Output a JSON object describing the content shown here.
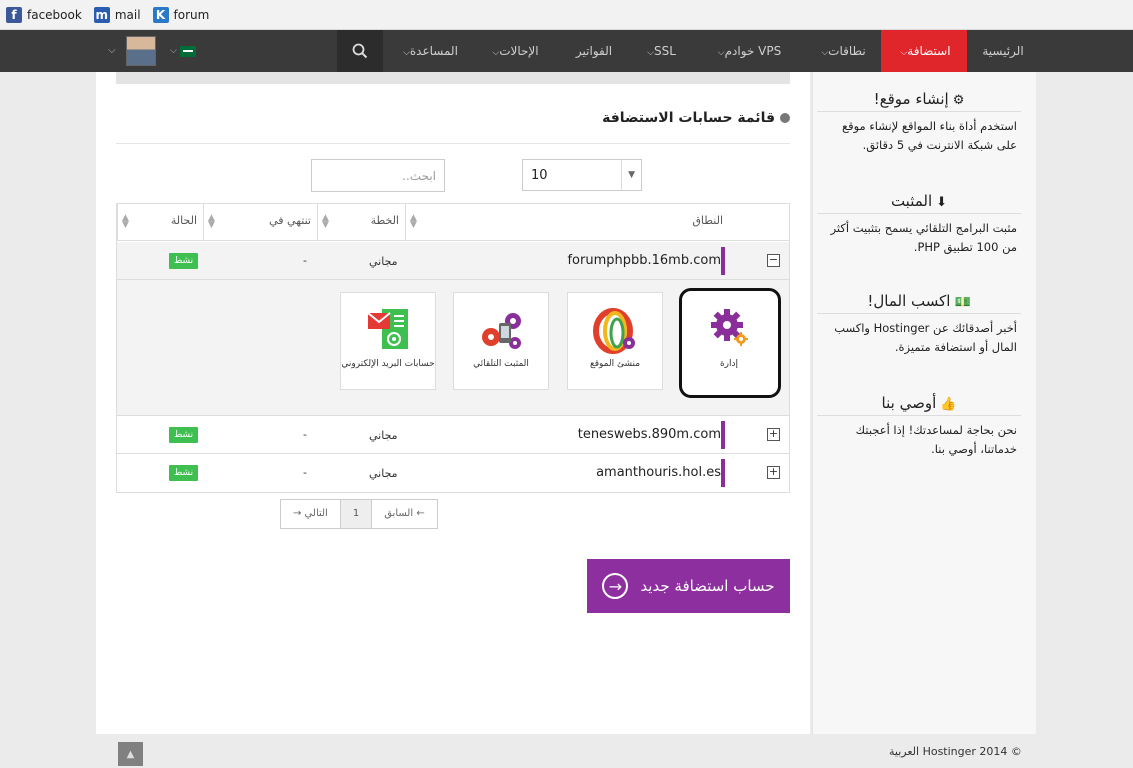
{
  "bookmarks": [
    {
      "label": "facebook",
      "icon": "facebook-icon"
    },
    {
      "label": "mail",
      "icon": "mail-icon"
    },
    {
      "label": "forum",
      "icon": "forum-icon"
    }
  ],
  "nav": {
    "home": "الرئيسية",
    "hosting": "استضافة",
    "domains": "نطاقات",
    "servers": "خوادم VPS",
    "ssl": "SSL",
    "invoices": "الفواتير",
    "referrals": "الإحالات",
    "help": "المساعدة"
  },
  "main": {
    "title": "قائمة حسابات الاستضافة",
    "page_size": "10",
    "search_placeholder": "ابحث..",
    "columns": {
      "domain": "النطاق",
      "plan": "الخطة",
      "expires": "تنتهي في",
      "status": "الحالة"
    },
    "rows": [
      {
        "domain": "forumphpbb.16mb.com",
        "plan": "مجاني",
        "expires": "-",
        "status": "نشط",
        "expand": "−"
      },
      {
        "domain": "teneswebs.890m.com",
        "plan": "مجاني",
        "expires": "-",
        "status": "نشط",
        "expand": "+"
      },
      {
        "domain": "amanthouris.hol.es",
        "plan": "مجاني",
        "expires": "-",
        "status": "نشط",
        "expand": "+"
      }
    ],
    "tiles": {
      "manage": "إدارة",
      "builder": "منشئ الموقع",
      "installer": "المثبت التلقائي",
      "email": "حسابات البريد الإلكتروني"
    },
    "pager": {
      "prev": "← السابق",
      "page": "1",
      "next": "التالي →"
    },
    "cta": "حساب استضافة جديد"
  },
  "sidebar": [
    {
      "title": "إنشاء موقع!",
      "text": "استخدم أداة بناء المواقع لإنشاء موقع على شبكة الانترنت في 5 دقائق."
    },
    {
      "title": "المثبت",
      "text": "مثبت البرامج التلقائي يسمح بتثبيت أكثر من 100 تطبيق PHP."
    },
    {
      "title": "اكسب المال!",
      "text": "أخبر أصدقائك عن Hostinger واكسب المال أو استضافة متميزة."
    },
    {
      "title": "أوصي بنا",
      "text": "نحن بحاجة لمساعدتك! إذا أعجبتك خدماتنا، أوصي بنا."
    }
  ],
  "footer": {
    "copyright": "© 2014 Hostinger العربية"
  },
  "colors": {
    "accent_red": "#e0252b",
    "accent_purple": "#8e2fa0",
    "status_green": "#3fbf4f",
    "nav_bg": "#3a3a3a"
  }
}
